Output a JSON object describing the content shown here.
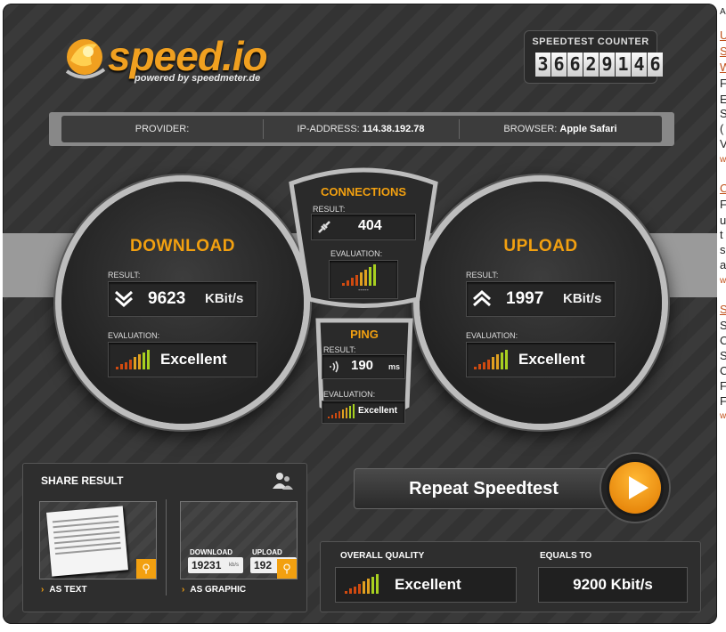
{
  "logo": {
    "word": "speed.io",
    "tagline": "powered by speedmeter.de"
  },
  "counter": {
    "label": "SPEEDTEST COUNTER",
    "digits": [
      "3",
      "6",
      "6",
      "2",
      "9",
      "1",
      "4",
      "6"
    ]
  },
  "info": {
    "provider_label": "PROVIDER:",
    "provider_value": "",
    "ip_label": "IP-ADDRESS:",
    "ip_value": "114.38.192.78",
    "browser_label": "BROWSER:",
    "browser_value": "Apple Safari"
  },
  "download": {
    "title": "DOWNLOAD",
    "result_label": "RESULT:",
    "value": "9623",
    "unit": "KBit/s",
    "eval_label": "EVALUATION:",
    "eval": "Excellent"
  },
  "upload": {
    "title": "UPLOAD",
    "result_label": "RESULT:",
    "value": "1997",
    "unit": "KBit/s",
    "eval_label": "EVALUATION:",
    "eval": "Excellent"
  },
  "connections": {
    "title": "CONNECTIONS",
    "result_label": "RESULT:",
    "value": "404",
    "eval_label": "EVALUATION:",
    "eval": "-----"
  },
  "ping": {
    "title": "PING",
    "result_label": "RESULT:",
    "value": "190",
    "unit": "ms",
    "eval_label": "EVALUATION:",
    "eval": "Excellent"
  },
  "share": {
    "title": "SHARE RESULT",
    "as_text": "AS TEXT",
    "as_graphic": "AS GRAPHIC",
    "graphic_preview": {
      "download_label": "DOWNLOAD",
      "upload_label": "UPLOAD",
      "download_value": "19231",
      "download_unit": "kb/s",
      "upload_value": "192"
    }
  },
  "repeat": {
    "label": "Repeat Speedtest"
  },
  "quality": {
    "overall_label": "OVERALL QUALITY",
    "overall_value": "Excellent",
    "equals_label": "EQUALS TO",
    "equals_value": "9200 Kbit/s"
  },
  "sidebar_fragments": {
    "top": "A",
    "lines": [
      "U",
      "S",
      "W",
      "F",
      "E",
      "S",
      "(",
      "V",
      "w",
      "C",
      "F",
      "u",
      "t",
      "s",
      "a",
      "w",
      "S",
      "S",
      "C",
      "S",
      "C",
      "F",
      "F",
      "w"
    ]
  },
  "colors": {
    "accent": "#f2a010",
    "bar_low": "#d04a10",
    "bar_high": "#a8d020"
  }
}
